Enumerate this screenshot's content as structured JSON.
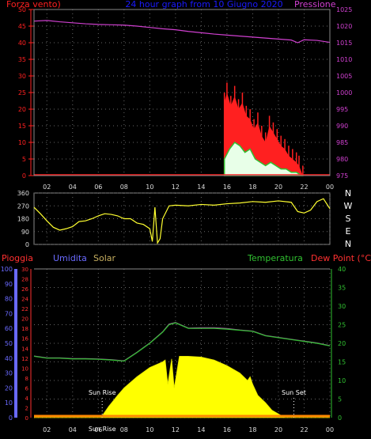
{
  "title": "24 hour graph from 10 Giugno 2020",
  "colors": {
    "wind": "#ff2020",
    "gust": "#30c030",
    "pressure": "#d040d0",
    "title": "#1a1aff",
    "direction": "#ffff30",
    "rain": "#ff3030",
    "humidity": "#6a6aff",
    "solar": "#c8b060",
    "solar_fill": "#ffff00",
    "temperature": "#30c030",
    "dewpoint": "#ff3030",
    "axis_left": "#ff3030",
    "axis_green": "#30c030",
    "axis_blue": "#6a6aff"
  },
  "chart_data": [
    {
      "type": "line",
      "panel": "wind",
      "legend": {
        "left": "Forza vento)",
        "right": "Pressione"
      },
      "y_left": {
        "label": "Forza vento)",
        "ticks": [
          0,
          5,
          10,
          15,
          20,
          25,
          30,
          35,
          40,
          45,
          50
        ],
        "ylim": [
          0,
          50
        ]
      },
      "y_right": {
        "label": "Pressione",
        "ticks": [
          975,
          980,
          985,
          990,
          995,
          1000,
          1005,
          1010,
          1015,
          1020,
          1025
        ],
        "ylim": [
          975,
          1025
        ]
      },
      "x_ticks": [
        "02",
        "04",
        "06",
        "08",
        "10",
        "12",
        "14",
        "16",
        "18",
        "20",
        "22",
        "00"
      ],
      "xlim": [
        1,
        24
      ],
      "series": [
        {
          "name": "Pressione",
          "axis": "right",
          "x": [
            1,
            2,
            3,
            4,
            5,
            6,
            7,
            8,
            9,
            10,
            11,
            12,
            13,
            14,
            15,
            16,
            17,
            18,
            19,
            20,
            21,
            21.5,
            22,
            23,
            24
          ],
          "y": [
            1021.5,
            1021.7,
            1021.3,
            1021.0,
            1020.7,
            1020.5,
            1020.4,
            1020.3,
            1020.0,
            1019.6,
            1019.2,
            1018.9,
            1018.4,
            1018.0,
            1017.6,
            1017.3,
            1017.0,
            1016.7,
            1016.4,
            1016.1,
            1015.8,
            1015.0,
            1015.9,
            1015.7,
            1015.1
          ]
        },
        {
          "name": "Forza vento",
          "axis": "left",
          "x": [
            15.8,
            16.0,
            16.3,
            16.6,
            16.9,
            17.2,
            17.5,
            17.8,
            18.1,
            18.4,
            18.7,
            19.0,
            19.3,
            19.6,
            19.9,
            20.2,
            20.5,
            20.8,
            21.1,
            21.4,
            21.6,
            21.9
          ],
          "y": [
            22,
            25,
            21,
            24,
            20,
            22,
            18,
            17,
            14,
            16,
            12,
            10,
            15,
            13,
            11,
            9,
            8,
            6,
            5,
            4,
            3,
            0
          ]
        },
        {
          "name": "Raffica",
          "axis": "left",
          "x": [
            15.8,
            16.2,
            16.6,
            17.0,
            17.4,
            17.8,
            18.2,
            18.6,
            19.0,
            19.4,
            19.8,
            20.2,
            20.6,
            21.0,
            21.4,
            21.8
          ],
          "y": [
            5,
            8,
            10,
            9,
            7,
            8,
            5,
            4,
            3,
            4,
            3,
            2,
            2,
            1,
            1,
            0
          ]
        }
      ]
    },
    {
      "type": "line",
      "panel": "direction",
      "y_left": {
        "ticks": [
          0,
          90,
          180,
          270,
          360
        ],
        "ylim": [
          0,
          360
        ]
      },
      "compass": [
        "N",
        "W",
        "S",
        "E",
        "N"
      ],
      "xlim": [
        1,
        24
      ],
      "series": [
        {
          "name": "direction",
          "x": [
            1,
            1.5,
            2,
            2.5,
            3,
            3.5,
            4,
            4.5,
            5,
            5.5,
            6,
            6.5,
            7,
            7.5,
            8,
            8.5,
            9,
            9.5,
            10,
            10.2,
            10.4,
            10.6,
            10.8,
            11,
            11.5,
            12,
            13,
            14,
            15,
            16,
            17,
            18,
            19,
            20,
            21,
            21.5,
            22,
            22.5,
            23,
            23.5,
            24
          ],
          "y": [
            260,
            215,
            165,
            120,
            100,
            110,
            125,
            160,
            165,
            180,
            200,
            215,
            210,
            200,
            180,
            180,
            150,
            140,
            110,
            20,
            260,
            10,
            40,
            180,
            270,
            275,
            270,
            280,
            275,
            285,
            290,
            300,
            295,
            305,
            295,
            230,
            220,
            240,
            300,
            320,
            250
          ]
        }
      ]
    },
    {
      "type": "area",
      "panel": "weather",
      "legend": [
        "Pioggia",
        "Umidita",
        "Solar",
        "Temperatura",
        "Dew Point (°C)"
      ],
      "y_blue": {
        "ticks": [
          0,
          10,
          20,
          30,
          40,
          50,
          60,
          70,
          80,
          90,
          100
        ],
        "ylim": [
          0,
          100
        ]
      },
      "y_red": {
        "ticks": [
          0,
          2,
          4,
          6,
          8,
          10,
          12,
          14,
          16,
          18,
          20,
          22,
          24,
          26,
          28,
          30
        ],
        "ylim": [
          0,
          30
        ]
      },
      "y_right": {
        "ticks": [
          0,
          5,
          10,
          15,
          20,
          25,
          30,
          35,
          40
        ],
        "ylim": [
          0,
          40
        ]
      },
      "x_ticks": [
        "02",
        "04",
        "06",
        "08",
        "10",
        "12",
        "14",
        "16",
        "18",
        "20",
        "22",
        "00"
      ],
      "xlim": [
        1,
        24
      ],
      "annotations": [
        {
          "text": "Sun Rise",
          "x": 6.3
        },
        {
          "text": "Sun Set",
          "x": 21.2
        },
        {
          "text": "Sun Rise",
          "x": 6.3
        }
      ],
      "series": [
        {
          "name": "Temperatura",
          "axis": "right",
          "x": [
            1,
            2,
            3,
            4,
            5,
            6,
            7,
            8,
            9,
            10,
            11,
            11.5,
            12,
            13,
            14,
            15,
            16,
            17,
            18,
            19,
            20,
            21,
            22,
            23,
            24
          ],
          "y": [
            16.5,
            16.0,
            16.0,
            15.8,
            15.8,
            15.7,
            15.5,
            15.2,
            17.5,
            20.0,
            23.0,
            25.0,
            25.5,
            24.0,
            24.0,
            24.0,
            23.8,
            23.5,
            23.2,
            22.0,
            21.5,
            21.0,
            20.5,
            20.0,
            19.3
          ]
        },
        {
          "name": "Dew Point (°C)",
          "axis": "right",
          "x": [
            1,
            2,
            3,
            4,
            5,
            6,
            7,
            8,
            9,
            10,
            11,
            11.5,
            12,
            13,
            14,
            15,
            16,
            17,
            18,
            19,
            20,
            21,
            22,
            23,
            24
          ],
          "y": [
            16.6,
            16.1,
            16.1,
            15.9,
            15.9,
            15.8,
            15.6,
            15.3,
            17.6,
            20.1,
            23.1,
            25.2,
            25.6,
            24.1,
            24.2,
            24.2,
            24.0,
            23.6,
            23.3,
            22.1,
            21.6,
            21.1,
            20.6,
            20.1,
            19.4
          ]
        },
        {
          "name": "Solar",
          "x": [
            1,
            6.2,
            6.8,
            7.5,
            8,
            9,
            10,
            11,
            11.2,
            11.4,
            11.7,
            11.9,
            12.3,
            13,
            14,
            15,
            16,
            17,
            17.6,
            17.8,
            18,
            18.4,
            19,
            19.5,
            20.5,
            24
          ],
          "y": [
            0,
            0,
            3,
            6,
            8,
            11,
            13.5,
            15,
            15.5,
            9,
            15.8,
            8,
            16.5,
            16.5,
            16.3,
            15.5,
            14,
            12,
            10,
            11,
            9,
            6,
            4,
            2,
            0,
            0
          ]
        }
      ]
    }
  ]
}
